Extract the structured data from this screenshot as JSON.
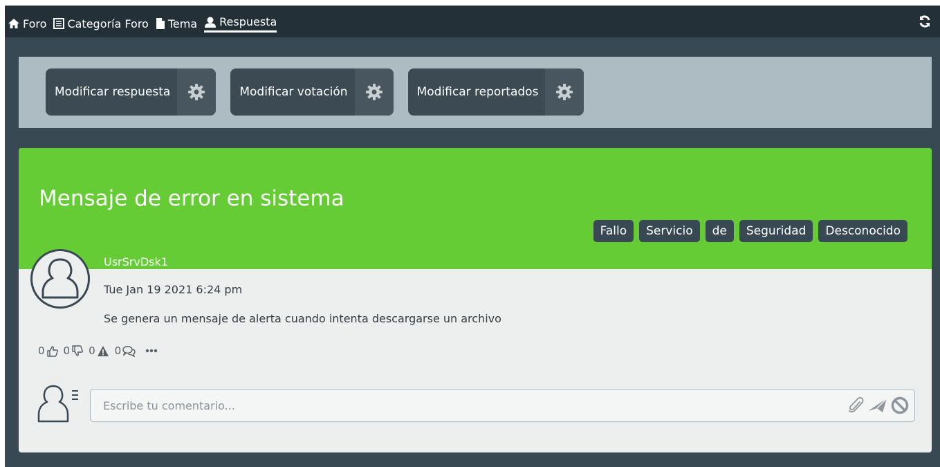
{
  "nav": {
    "items": [
      {
        "label": "Foro",
        "icon": "home-icon"
      },
      {
        "label": "Categoría Foro",
        "icon": "list-icon"
      },
      {
        "label": "Tema",
        "icon": "document-icon"
      },
      {
        "label": "Respuesta",
        "icon": "user-icon"
      }
    ],
    "active": "Respuesta",
    "refresh_icon": "refresh-icon"
  },
  "actions": [
    {
      "label": "Modificar respuesta",
      "icon": "gear-icon"
    },
    {
      "label": "Modificar votación",
      "icon": "gear-icon"
    },
    {
      "label": "Modificar reportados",
      "icon": "gear-icon"
    }
  ],
  "post": {
    "title": "Mensaje de error en sistema",
    "tags": [
      "Fallo",
      "Servicio",
      "de",
      "Seguridad",
      "Desconocido"
    ],
    "author": "UsrSrvDsk1",
    "date": "Tue Jan 19 2021 6:24 pm",
    "body": "Se genera un mensaje de alerta cuando intenta descargarse un archivo",
    "stats": {
      "likes": "0",
      "dislikes": "0",
      "reports": "0",
      "comments": "0"
    }
  },
  "comment": {
    "placeholder": "Escribe tu comentario..."
  },
  "colors": {
    "header_green": "#65cc35",
    "dark_bg": "#394954",
    "nav_bg": "#243038",
    "action_bar": "#adbbc3"
  }
}
